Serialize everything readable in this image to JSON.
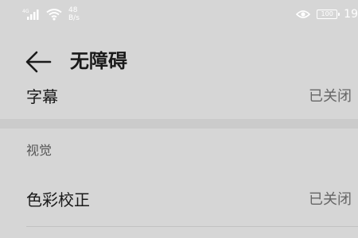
{
  "status_bar": {
    "network_type": "4G",
    "net_speed_value": "48",
    "net_speed_unit": "B/s",
    "battery_level": "100",
    "time": "19",
    "icons": [
      "signal-icon",
      "wifi-icon",
      "eye-icon",
      "battery-icon"
    ]
  },
  "header": {
    "title": "无障碍",
    "back_icon": "arrow-left-icon"
  },
  "rows": {
    "subtitles": {
      "label": "字幕",
      "value": "已关闭"
    },
    "color_correction": {
      "label": "色彩校正",
      "value": "已关闭"
    }
  },
  "sections": {
    "vision": {
      "header": "视觉"
    }
  },
  "colors": {
    "background": "#d6d6d6",
    "primary_text": "#1a1a1a",
    "secondary_text": "#666666",
    "status_bar_text": "#ffffff"
  }
}
